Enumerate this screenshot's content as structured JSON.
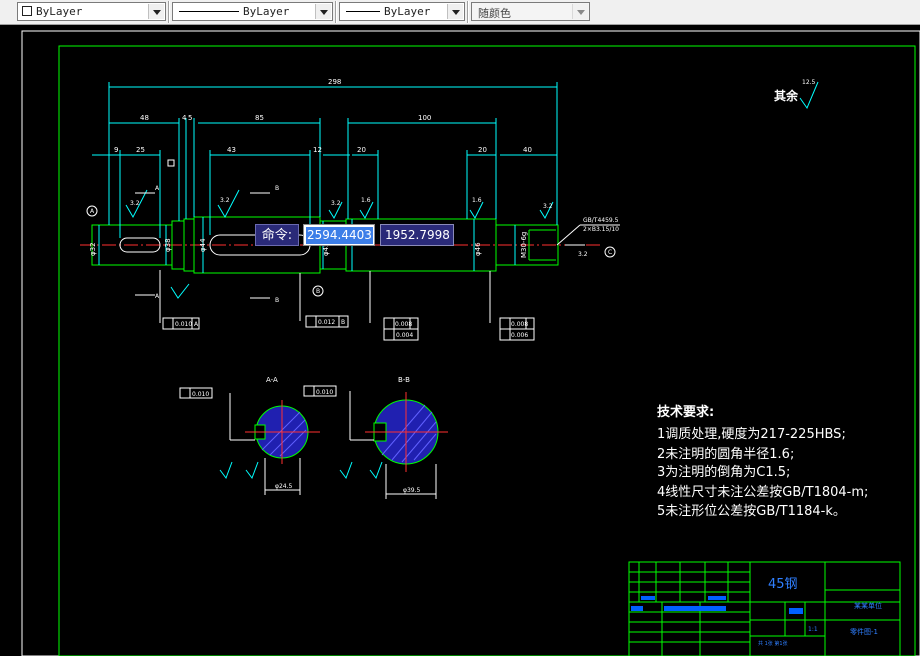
{
  "toolbar": {
    "color_value": "ByLayer",
    "linetype_value": "ByLayer",
    "lineweight_value": "ByLayer",
    "plotstyle_value": "随颜色"
  },
  "drawing": {
    "overall_length": "298",
    "dim_48": "48",
    "dim_9": "9",
    "dim_25": "25",
    "dim_4": "4",
    "dim_5": "5",
    "dim_85": "85",
    "dim_43": "43",
    "dim_12": "12",
    "dim_100": "100",
    "dim_20a": "20",
    "dim_20b": "20",
    "dim_40": "40",
    "rough_32": "3.2",
    "rough_16": "1.6",
    "rough_125": "12.5",
    "rest_label": "其余",
    "thread_note_1": "GB/T4459.5",
    "thread_note_2": "2×B3.15/10",
    "thread_dia": "M30-6g",
    "dia_32": "φ32",
    "dia_38": "φ38",
    "dia_44": "φ44",
    "dia_45": "φ45",
    "dia_46": "φ46",
    "dia_40": "φ40",
    "section_aa_title": "A-A",
    "section_bb_title": "B-B",
    "tol_a": "0.010",
    "tol_b": "0.012",
    "tol_c": "0.008",
    "tol_d": "0.004",
    "tol_e": "0.008",
    "tol_f": "0.006",
    "sec_tol_a": "0.010",
    "sec_tol_b": "0.010",
    "sec_dim_a": "φ24.5",
    "sec_dim_b": "φ39.5",
    "datum_a": "A",
    "datum_b": "B",
    "circle_a": "A",
    "circle_b": "B",
    "circle_c": "C"
  },
  "notes": {
    "title": "技术要求:",
    "line1": "1调质处理,硬度为217-225HBS;",
    "line2": "2未注明的圆角半径1.6;",
    "line3": "3为注明的倒角为C1.5;",
    "line4": "4线性尺寸未注公差按GB/T1804-m;",
    "line5": "5未注形位公差按GB/T1184-k。"
  },
  "title_block": {
    "material": "45钢",
    "company": "某某单位",
    "drawing_no": "零件图-1",
    "scale": "1:1",
    "sheet": "共 1张 第1张"
  },
  "command": {
    "label": "命令:",
    "x_value": "2594.4403",
    "y_value": "1952.7998"
  }
}
